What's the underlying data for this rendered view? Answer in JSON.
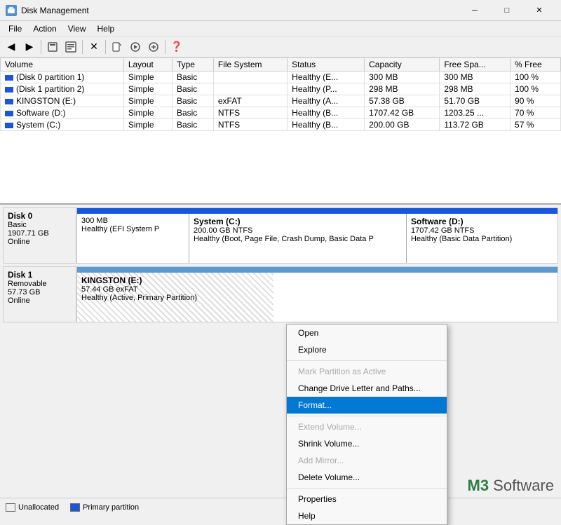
{
  "window": {
    "title": "Disk Management",
    "icon": "disk-icon"
  },
  "menu": [
    "File",
    "Action",
    "View",
    "Help"
  ],
  "toolbar": {
    "buttons": [
      "◀",
      "▶",
      "📋",
      "⬆",
      "🔄",
      "✕",
      "📄",
      "📤",
      "📥",
      "❓"
    ]
  },
  "table": {
    "columns": [
      "Volume",
      "Layout",
      "Type",
      "File System",
      "Status",
      "Capacity",
      "Free Spa...",
      "% Free"
    ],
    "rows": [
      {
        "icon": true,
        "volume": "(Disk 0 partition 1)",
        "layout": "Simple",
        "type": "Basic",
        "fs": "",
        "status": "Healthy (E...",
        "capacity": "300 MB",
        "free": "300 MB",
        "pct": "100 %"
      },
      {
        "icon": true,
        "volume": "(Disk 1 partition 2)",
        "layout": "Simple",
        "type": "Basic",
        "fs": "",
        "status": "Healthy (P...",
        "capacity": "298 MB",
        "free": "298 MB",
        "pct": "100 %"
      },
      {
        "icon": true,
        "volume": "KINGSTON (E:)",
        "layout": "Simple",
        "type": "Basic",
        "fs": "exFAT",
        "status": "Healthy (A...",
        "capacity": "57.38 GB",
        "free": "51.70 GB",
        "pct": "90 %"
      },
      {
        "icon": true,
        "volume": "Software (D:)",
        "layout": "Simple",
        "type": "Basic",
        "fs": "NTFS",
        "status": "Healthy (B...",
        "capacity": "1707.42 GB",
        "free": "1203.25 ...",
        "pct": "70 %"
      },
      {
        "icon": true,
        "volume": "System (C:)",
        "layout": "Simple",
        "type": "Basic",
        "fs": "NTFS",
        "status": "Healthy (B...",
        "capacity": "200.00 GB",
        "free": "113.72 GB",
        "pct": "57 %"
      }
    ]
  },
  "disks": {
    "disk0": {
      "label": "Disk 0",
      "type": "Basic",
      "size": "1907.71 GB",
      "status": "Online",
      "partitions": [
        {
          "id": "efi",
          "name": "",
          "size": "300 MB",
          "fs": "",
          "desc": "Healthy (EFI System P"
        },
        {
          "id": "system",
          "name": "System (C:)",
          "size": "200.00 GB NTFS",
          "desc": "Healthy (Boot, Page File, Crash Dump, Basic Data P"
        },
        {
          "id": "software",
          "name": "Software (D:)",
          "size": "1707.42 GB NTFS",
          "desc": "Healthy (Basic Data Partition)"
        }
      ]
    },
    "disk1": {
      "label": "Disk 1",
      "type": "Removable",
      "size": "57.73 GB",
      "status": "Online",
      "partitions": [
        {
          "id": "kingston",
          "name": "KINGSTON (E:)",
          "size": "57.44 GB exFAT",
          "desc": "Healthy (Active, Primary Partition)"
        }
      ]
    }
  },
  "context_menu": {
    "items": [
      {
        "label": "Open",
        "disabled": false,
        "highlighted": false,
        "separator_after": false
      },
      {
        "label": "Explore",
        "disabled": false,
        "highlighted": false,
        "separator_after": true
      },
      {
        "label": "Mark Partition as Active",
        "disabled": true,
        "highlighted": false,
        "separator_after": false
      },
      {
        "label": "Change Drive Letter and Paths...",
        "disabled": false,
        "highlighted": false,
        "separator_after": false
      },
      {
        "label": "Format...",
        "disabled": false,
        "highlighted": true,
        "separator_after": true
      },
      {
        "label": "Extend Volume...",
        "disabled": true,
        "highlighted": false,
        "separator_after": false
      },
      {
        "label": "Shrink Volume...",
        "disabled": false,
        "highlighted": false,
        "separator_after": false
      },
      {
        "label": "Add Mirror...",
        "disabled": true,
        "highlighted": false,
        "separator_after": false
      },
      {
        "label": "Delete Volume...",
        "disabled": false,
        "highlighted": false,
        "separator_after": true
      },
      {
        "label": "Properties",
        "disabled": false,
        "highlighted": false,
        "separator_after": false
      },
      {
        "label": "Help",
        "disabled": false,
        "highlighted": false,
        "separator_after": false
      }
    ]
  },
  "legend": {
    "items": [
      {
        "label": "Unallocated",
        "type": "unalloc"
      },
      {
        "label": "Primary partition",
        "type": "primary"
      }
    ]
  },
  "watermark": {
    "brand": "M3",
    "suffix": " Software"
  }
}
